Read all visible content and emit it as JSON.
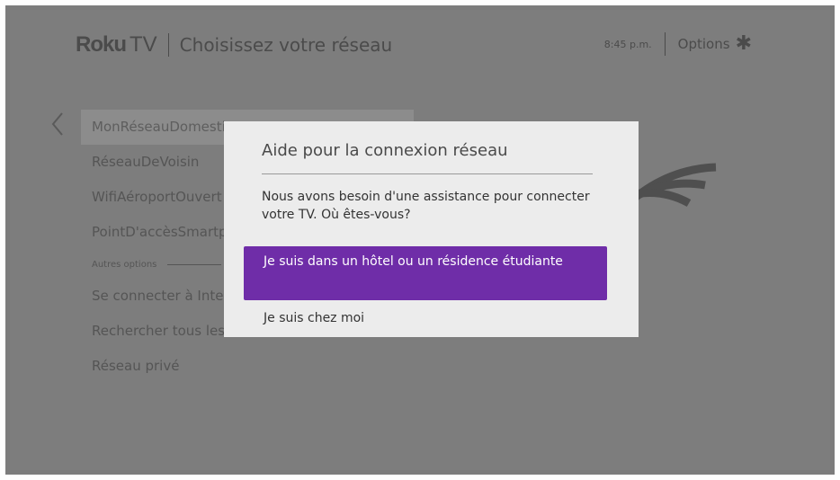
{
  "header": {
    "brand_roku": "Roku",
    "brand_tv": "TV",
    "title": "Choisissez votre réseau",
    "time": "8:45 p.m.",
    "options_label": "Options",
    "options_icon": "asterisk-icon"
  },
  "networks": {
    "items": [
      "MonRéseauDomestique",
      "RéseauDeVoisin",
      "WifiAéroportOuvert",
      "PointD'accèsSmartphone"
    ],
    "other_label": "Autres options",
    "other_items": [
      "Se connecter à Internet",
      "Rechercher tous les réseaux",
      "Réseau privé"
    ]
  },
  "dialog": {
    "title": "Aide pour la connexion réseau",
    "message": "Nous avons besoin d'une assistance pour connecter votre TV. Où êtes-vous?",
    "options": [
      "Je suis dans un hôtel ou un résidence étudiante",
      "Je suis chez moi"
    ]
  },
  "colors": {
    "accent": "#6f2da8",
    "overlay": "#7d7d7d",
    "dialog_bg": "#ececec"
  }
}
